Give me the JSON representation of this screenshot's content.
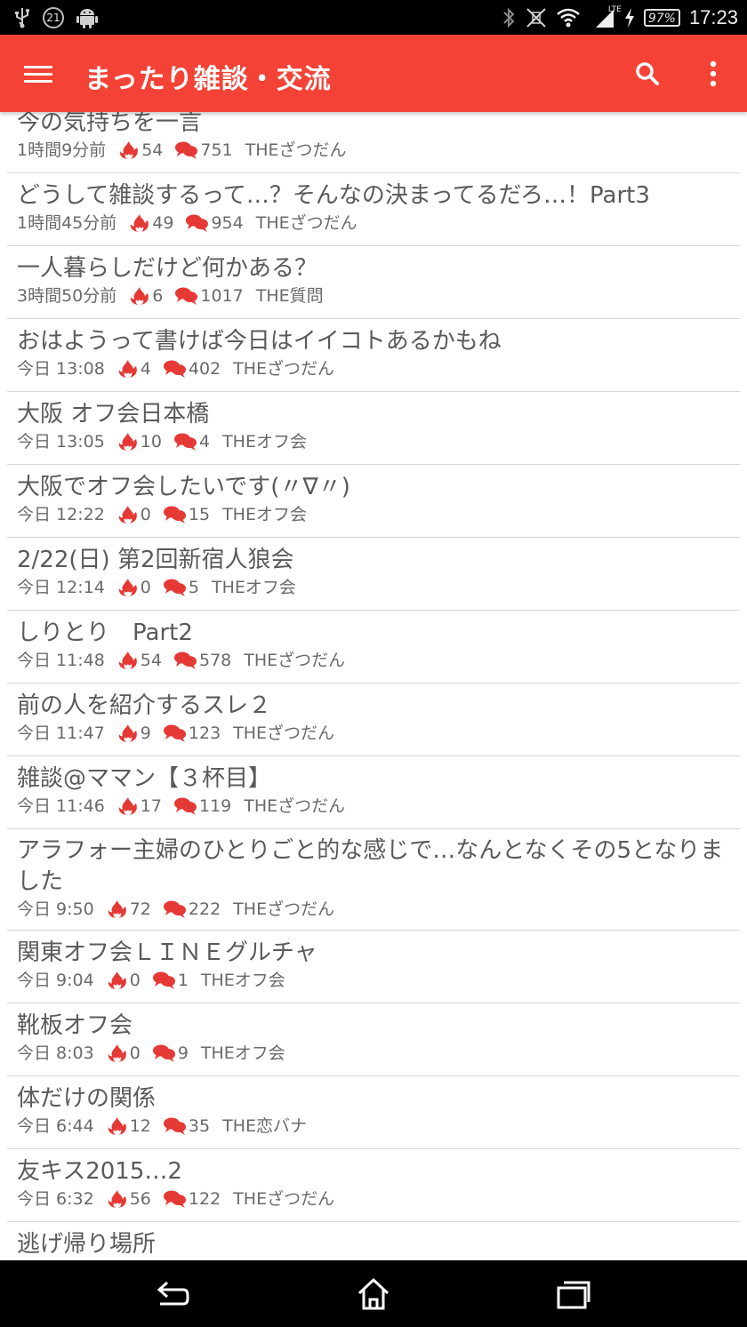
{
  "status_bar": {
    "notification_count": "21",
    "network_type": "LTE",
    "battery": "97%",
    "time": "17:23"
  },
  "app_bar": {
    "title": "まったり雑談・交流",
    "color": "#f44336"
  },
  "threads": [
    {
      "title": "今の気持ちを一言",
      "time": "1時間9分前",
      "heat": "54",
      "replies": "751",
      "category": "THEざつだん"
    },
    {
      "title": "どうして雑談するって…？そんなの決まってるだろ…！Part3",
      "time": "1時間45分前",
      "heat": "49",
      "replies": "954",
      "category": "THEざつだん"
    },
    {
      "title": "一人暮らしだけど何かある？",
      "time": "3時間50分前",
      "heat": "6",
      "replies": "1017",
      "category": "THE質問"
    },
    {
      "title": "おはようって書けば今日はイイコトあるかもね",
      "time": "今日 13:08",
      "heat": "4",
      "replies": "402",
      "category": "THEざつだん"
    },
    {
      "title": "大阪 オフ会日本橋",
      "time": "今日 13:05",
      "heat": "10",
      "replies": "4",
      "category": "THEオフ会"
    },
    {
      "title": "大阪でオフ会したいです(〃∇〃)",
      "time": "今日 12:22",
      "heat": "0",
      "replies": "15",
      "category": "THEオフ会"
    },
    {
      "title": "2/22(日) 第2回新宿人狼会",
      "time": "今日 12:14",
      "heat": "0",
      "replies": "5",
      "category": "THEオフ会"
    },
    {
      "title": "しりとり　Part2",
      "time": "今日 11:48",
      "heat": "54",
      "replies": "578",
      "category": "THEざつだん"
    },
    {
      "title": "前の人を紹介するスレ２",
      "time": "今日 11:47",
      "heat": "9",
      "replies": "123",
      "category": "THEざつだん"
    },
    {
      "title": "雑談@ママン【３杯目】",
      "time": "今日 11:46",
      "heat": "17",
      "replies": "119",
      "category": "THEざつだん"
    },
    {
      "title": "アラフォー主婦のひとりごと的な感じで…なんとなくその5となりました",
      "time": "今日 9:50",
      "heat": "72",
      "replies": "222",
      "category": "THEざつだん",
      "two_line": true
    },
    {
      "title": "関東オフ会ＬＩＮＥグルチャ",
      "time": "今日 9:04",
      "heat": "0",
      "replies": "1",
      "category": "THEオフ会"
    },
    {
      "title": "靴板オフ会",
      "time": "今日 8:03",
      "heat": "0",
      "replies": "9",
      "category": "THEオフ会"
    },
    {
      "title": "体だけの関係",
      "time": "今日 6:44",
      "heat": "12",
      "replies": "35",
      "category": "THE恋バナ"
    },
    {
      "title": "友キス2015…2",
      "time": "今日 6:32",
      "heat": "56",
      "replies": "122",
      "category": "THEざつだん"
    },
    {
      "title": "逃げ帰り場所",
      "time": "",
      "heat": "",
      "replies": "",
      "category": ""
    }
  ],
  "icons": {
    "heat": "flame-icon",
    "replies": "speech-bubbles-icon",
    "accent": "#e53935"
  }
}
